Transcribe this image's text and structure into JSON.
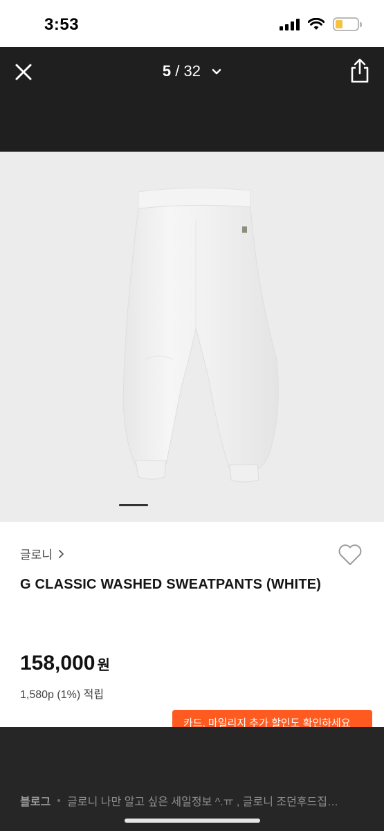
{
  "status_bar": {
    "time": "3:53"
  },
  "nav": {
    "current_page": "5",
    "separator": " / ",
    "total_pages": "32"
  },
  "product": {
    "brand": "글로니",
    "name": "G CLASSIC WASHED SWEATPANTS (WHITE)",
    "price": "158,000",
    "currency": "원",
    "points": "1,580p (1%) 적립"
  },
  "promo": {
    "text": "카드, 마일리지 추가 할인도 확인하세요"
  },
  "blog": {
    "label": "블로그",
    "text": "글로니 나만 알고 싶은 세일정보 ^.ㅠ , 글로니 조던후드집…"
  },
  "colors": {
    "nav_bg": "#1f1f1f",
    "promo_bg": "#ff5a1f",
    "battery": "#f5c242"
  }
}
